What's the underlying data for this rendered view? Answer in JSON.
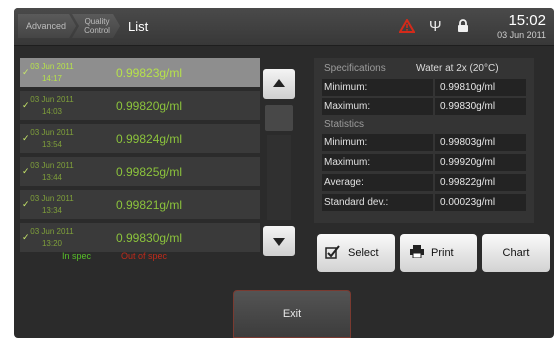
{
  "header": {
    "breadcrumbs": [
      {
        "label": "Advanced"
      },
      {
        "line1": "Quality",
        "line2": "Control"
      }
    ],
    "title": "List",
    "time": "15:02",
    "date": "03 Jun 2011",
    "icons": [
      "warning-icon",
      "usb-icon",
      "lock-icon"
    ],
    "warning_color": "#d42a1a"
  },
  "results": [
    {
      "date": "03 Jun 2011",
      "time": "14:17",
      "value": "0.99823g/ml",
      "in_spec": true,
      "selected": true
    },
    {
      "date": "03 Jun 2011",
      "time": "14:03",
      "value": "0.99820g/ml",
      "in_spec": true,
      "selected": false
    },
    {
      "date": "03 Jun 2011",
      "time": "13:54",
      "value": "0.99824g/ml",
      "in_spec": true,
      "selected": false
    },
    {
      "date": "03 Jun 2011",
      "time": "13:44",
      "value": "0.99825g/ml",
      "in_spec": true,
      "selected": false
    },
    {
      "date": "03 Jun 2011",
      "time": "13:34",
      "value": "0.99821g/ml",
      "in_spec": true,
      "selected": false
    },
    {
      "date": "03 Jun 2011",
      "time": "13:20",
      "value": "0.99830g/ml",
      "in_spec": true,
      "selected": false
    }
  ],
  "legend": {
    "in_spec": "In spec",
    "out_of_spec": "Out of spec",
    "in_color": "#58c028",
    "out_color": "#c02a1a"
  },
  "details": {
    "spec_label": "Specifications",
    "spec_value": "Water at 2x (20°C)",
    "min_label": "Minimum:",
    "min_value": "0.99810g/ml",
    "max_label": "Maximum:",
    "max_value": "0.99830g/ml",
    "stats_label": "Statistics",
    "stat_min_label": "Minimum:",
    "stat_min_value": "0.99803g/ml",
    "stat_max_label": "Maximum:",
    "stat_max_value": "0.99920g/ml",
    "avg_label": "Average:",
    "avg_value": "0.99822g/ml",
    "sd_label": "Standard dev.:",
    "sd_value": "0.00023g/ml"
  },
  "actions": {
    "select": "Select",
    "print": "Print",
    "chart": "Chart",
    "exit": "Exit"
  }
}
